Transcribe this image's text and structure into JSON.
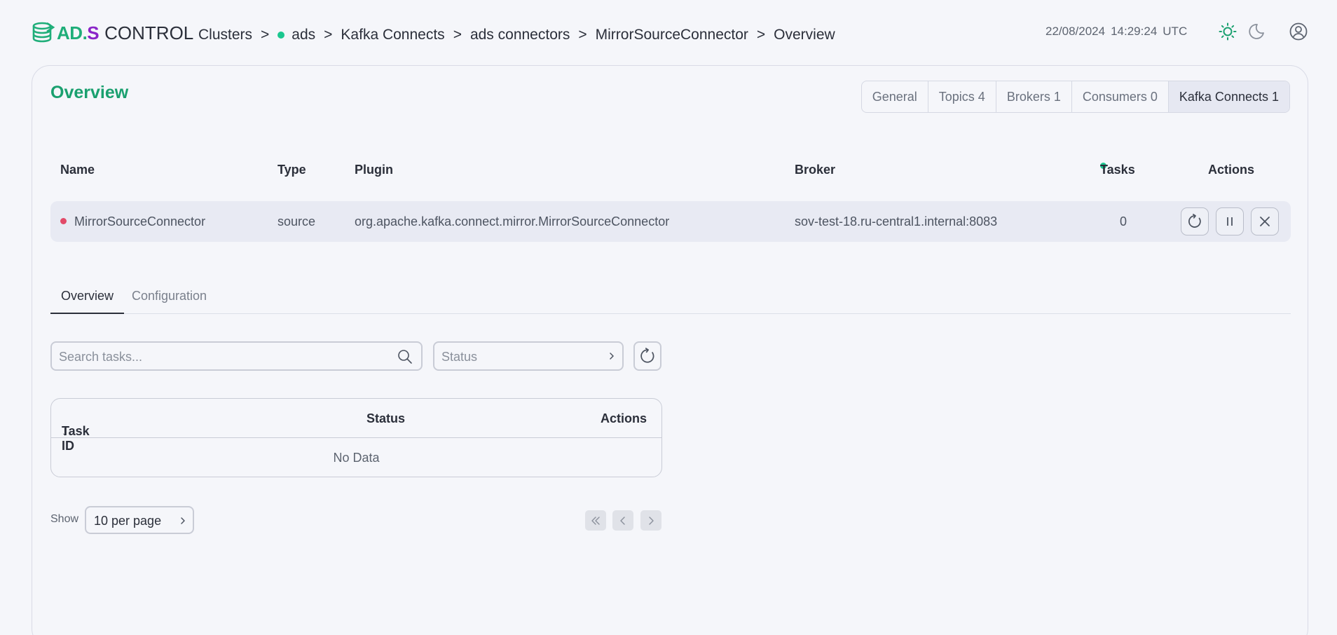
{
  "app": {
    "logo": {
      "ad": "AD",
      "dot": ".",
      "s": "S",
      "control": "CONTROL"
    }
  },
  "breadcrumb": {
    "items": [
      "Clusters",
      "ads",
      "Kafka Connects",
      "ads connectors",
      "MirrorSourceConnector",
      "Overview"
    ],
    "separator": ">"
  },
  "header": {
    "date": "22/08/2024",
    "time": "14:29:24",
    "timezone": "UTC"
  },
  "page": {
    "title": "Overview",
    "tabs": [
      {
        "label": "General",
        "active": false
      },
      {
        "label": "Topics 4",
        "active": false
      },
      {
        "label": "Brokers 1",
        "active": false
      },
      {
        "label": "Consumers 0",
        "active": false
      },
      {
        "label": "Kafka Connects 1",
        "active": true
      }
    ]
  },
  "connector_table": {
    "columns": {
      "name": "Name",
      "type": "Type",
      "plugin": "Plugin",
      "broker": "Broker",
      "tasks": "Tasks",
      "actions": "Actions"
    },
    "row": {
      "name": "MirrorSourceConnector",
      "type": "source",
      "plugin": "org.apache.kafka.connect.mirror.MirrorSourceConnector",
      "broker": "sov-test-18.ru-central1.internal:8083",
      "tasks": "0",
      "status_color": "#e24a68"
    }
  },
  "sub_tabs": [
    {
      "label": "Overview",
      "active": true
    },
    {
      "label": "Configuration",
      "active": false
    }
  ],
  "filters": {
    "search_placeholder": "Search tasks...",
    "status_placeholder": "Status"
  },
  "tasks_table": {
    "columns": {
      "task_id": "Task ID",
      "sort_indicator": "↓",
      "status": "Status",
      "actions": "Actions"
    },
    "empty_text": "No Data"
  },
  "pagination": {
    "show_label": "Show",
    "per_page": "10 per page"
  },
  "colors": {
    "accent_green": "#1aa06f",
    "status_green": "#1bc78f",
    "status_red": "#e24a68",
    "brand_purple": "#8a25c8"
  }
}
